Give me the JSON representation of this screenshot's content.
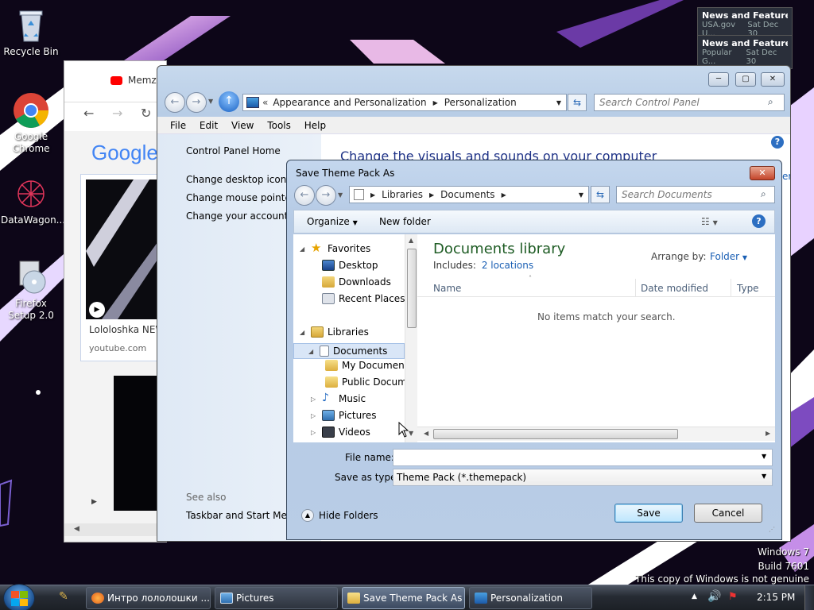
{
  "desktop": {
    "icons": [
      {
        "label": "Recycle Bin"
      },
      {
        "label": "Google Chrome"
      },
      {
        "label": "DataWagon..."
      },
      {
        "label": "Firefox Setup 2.0"
      }
    ],
    "watermark": [
      "Windows 7",
      "Build 7601",
      "This copy of Windows is not genuine"
    ]
  },
  "notifications": [
    {
      "title": "News and Features f...",
      "source": "USA.gov U...",
      "date": "Sat Dec 30"
    },
    {
      "title": "News and Feature...",
      "source": "Popular G...",
      "date": "Sat Dec 30"
    }
  ],
  "chrome": {
    "tab": "Memz...",
    "logo": "Google",
    "card_title": "Lololoshka NEW",
    "card_domain": "youtube.com"
  },
  "control_panel": {
    "breadcrumb": [
      "Appearance and Personalization",
      "Personalization"
    ],
    "search_placeholder": "Search Control Panel",
    "menu": [
      "File",
      "Edit",
      "View",
      "Tools",
      "Help"
    ],
    "sidebar": [
      "Control Panel Home",
      "Change desktop icons",
      "Change mouse pointers",
      "Change your account pi"
    ],
    "heading": "Change the visuals and sounds on your computer",
    "see_also": "See also",
    "see_also_links": [
      "Taskbar and Start Menu"
    ],
    "right_edge_text": "er"
  },
  "dialog": {
    "title": "Save Theme Pack As",
    "breadcrumb": [
      "Libraries",
      "Documents"
    ],
    "search_placeholder": "Search Documents",
    "organize": "Organize",
    "new_folder": "New folder",
    "tree": [
      {
        "label": "Favorites",
        "level": 0,
        "toggle": "open"
      },
      {
        "label": "Desktop",
        "level": 1,
        "toggle": ""
      },
      {
        "label": "Downloads",
        "level": 1,
        "toggle": ""
      },
      {
        "label": "Recent Places",
        "level": 1,
        "toggle": ""
      },
      {
        "label": "Libraries",
        "level": 0,
        "toggle": "open"
      },
      {
        "label": "Documents",
        "level": 1,
        "toggle": "open",
        "selected": true
      },
      {
        "label": "My Documents",
        "level": 2,
        "toggle": ""
      },
      {
        "label": "Public Docume",
        "level": 2,
        "toggle": ""
      },
      {
        "label": "Music",
        "level": 1,
        "toggle": "closed"
      },
      {
        "label": "Pictures",
        "level": 1,
        "toggle": "closed"
      },
      {
        "label": "Videos",
        "level": 1,
        "toggle": "closed"
      }
    ],
    "library_title": "Documents library",
    "includes_label": "Includes:",
    "includes_link": "2 locations",
    "arrange_label": "Arrange by:",
    "arrange_value": "Folder",
    "columns": [
      "Name",
      "Date modified",
      "Type"
    ],
    "empty_message": "No items match your search.",
    "file_name_label": "File name:",
    "file_name_value": "",
    "save_type_label": "Save as type:",
    "save_type_value": "Theme Pack (*.themepack)",
    "hide_folders": "Hide Folders",
    "save": "Save",
    "cancel": "Cancel"
  },
  "taskbar": {
    "items": [
      "Интро лололошки ...",
      "Pictures",
      "Save Theme Pack As",
      "Personalization"
    ],
    "clock": "2:15 PM"
  }
}
